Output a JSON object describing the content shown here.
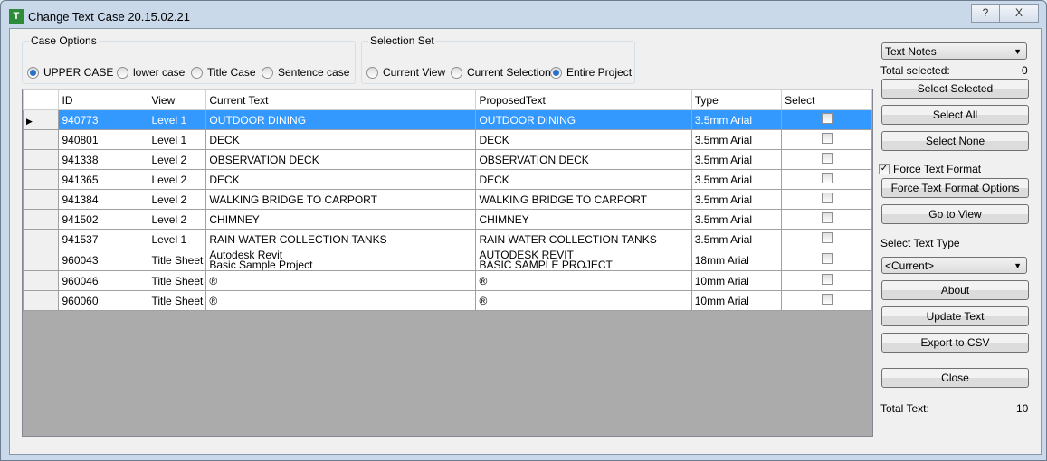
{
  "window": {
    "title": "Change Text Case 20.15.02.21",
    "help": "?",
    "close": "X"
  },
  "case_options": {
    "label": "Case Options",
    "options": [
      "UPPER CASE",
      "lower case",
      "Title Case",
      "Sentence case"
    ],
    "selected": 0
  },
  "selection_set": {
    "label": "Selection Set",
    "options": [
      "Current View",
      "Current Selection",
      "Entire Project"
    ],
    "selected": 2
  },
  "grid": {
    "columns": [
      "ID",
      "View",
      "Current Text",
      "ProposedText",
      "Type",
      "Select"
    ],
    "rows": [
      [
        "940773",
        "Level 1",
        "OUTDOOR DINING",
        "",
        "OUTDOOR DINING",
        "",
        "3.5mm Arial"
      ],
      [
        "940801",
        "Level 1",
        "DECK",
        "",
        "DECK",
        "",
        "3.5mm Arial"
      ],
      [
        "941338",
        "Level 2",
        "OBSERVATION DECK",
        "",
        "OBSERVATION DECK",
        "",
        "3.5mm Arial"
      ],
      [
        "941365",
        "Level 2",
        "DECK",
        "",
        "DECK",
        "",
        "3.5mm Arial"
      ],
      [
        "941384",
        "Level 2",
        "WALKING BRIDGE TO CARPORT",
        "",
        "WALKING BRIDGE TO CARPORT",
        "",
        "3.5mm Arial"
      ],
      [
        "941502",
        "Level 2",
        "CHIMNEY",
        "",
        "CHIMNEY",
        "",
        "3.5mm Arial"
      ],
      [
        "941537",
        "Level 1",
        "RAIN WATER COLLECTION TANKS",
        "",
        "RAIN WATER COLLECTION TANKS",
        "",
        "3.5mm Arial"
      ],
      [
        "960043",
        "Title Sheet",
        "Autodesk  Revit",
        "Basic Sample Project",
        "AUTODESK  REVIT",
        "BASIC SAMPLE PROJECT",
        "18mm Arial"
      ],
      [
        "960046",
        "Title Sheet",
        "®",
        "",
        "®",
        "",
        "10mm Arial"
      ],
      [
        "960060",
        "Title Sheet",
        "®",
        "",
        "®",
        "",
        "10mm Arial"
      ]
    ],
    "selected_row": 0
  },
  "side": {
    "type_dropdown": "Text Notes",
    "total_selected_label": "Total selected:",
    "total_selected": "0",
    "select_selected": "Select Selected",
    "select_all": "Select All",
    "select_none": "Select None",
    "force_text_format": "Force Text Format",
    "force_checked": true,
    "force_options": "Force Text Format Options",
    "go_to_view": "Go to View",
    "select_text_type_label": "Select Text Type",
    "text_type": "<Current>",
    "about": "About",
    "update_text": "Update Text",
    "export_csv": "Export to CSV",
    "close": "Close",
    "total_text_label": "Total Text:",
    "total_text": "10"
  }
}
